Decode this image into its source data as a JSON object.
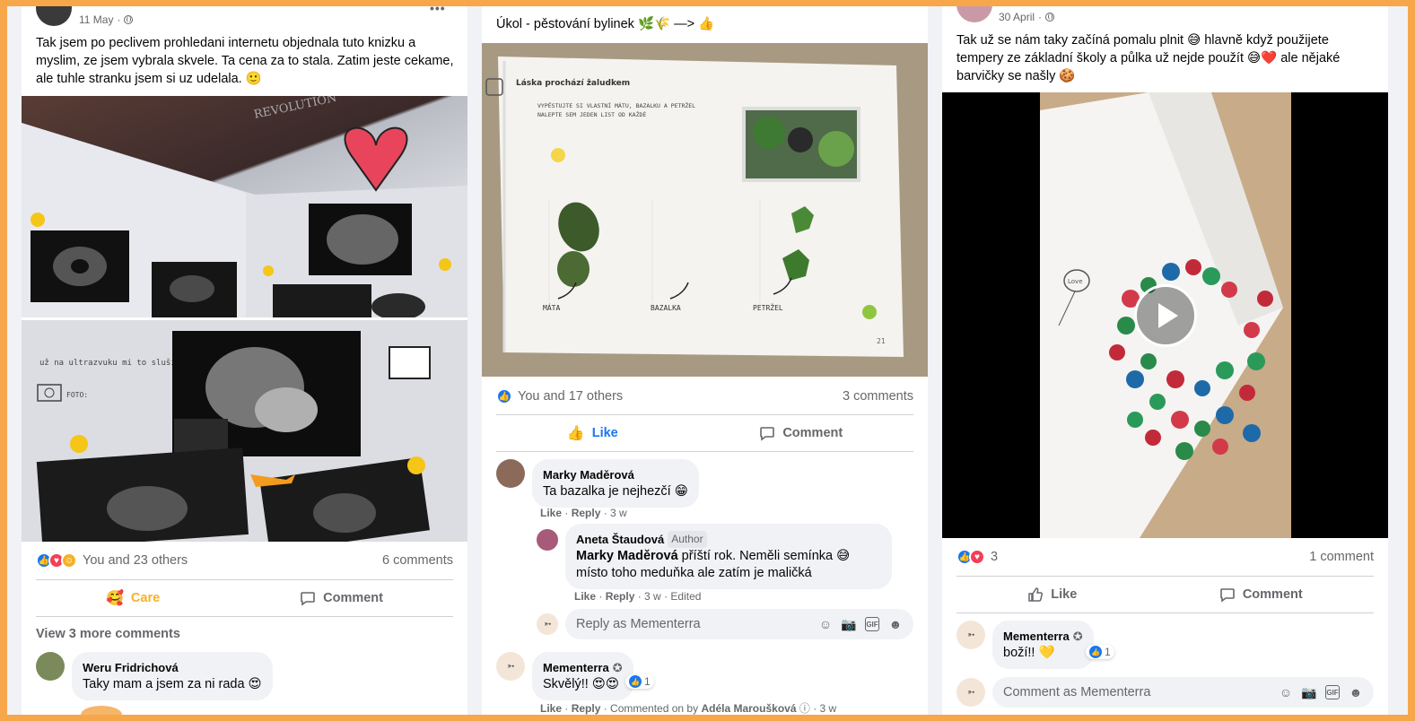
{
  "posts": [
    {
      "date": "11 May",
      "text": "Tak jsem po peclivem prohledani internetu objednala tuto knizku a myslim, ze jsem vybrala skvele. Ta cena za to stala. Zatim jeste cekame, ale tuhle stranku jsem si uz udelala. 🙂",
      "photo_caption": "už na ultrazvuku mi to sluší.",
      "photo_logo": "REVOLUTION",
      "photo_foto": "FOTO:",
      "reactions_text": "You and 23 others",
      "comments_count": "6 comments",
      "action_primary": "Care",
      "action_comment": "Comment",
      "view_more": "View 3 more comments",
      "comments": [
        {
          "name": "Weru Fridrichová",
          "text": "Taky mam a jsem za ni rada 😍"
        }
      ]
    },
    {
      "title": "Úkol - pěstování bylinek 🌿🌾 —> 👍",
      "photo_header": "Láska prochází žaludkem",
      "photo_instructions": "VYPĚSTUJTE SI VLASTNÍ MÁTU, BAZALKU A PETRŽEL. NALEPTE SEM JEDEN LIST OD KAŽDÉ.",
      "herb_labels": [
        "MÁTA",
        "BAZALKA",
        "PETRŽEL"
      ],
      "page_number": "21",
      "reactions_text": "You and 17 others",
      "comments_count": "3 comments",
      "action_primary": "Like",
      "action_comment": "Comment",
      "comments": [
        {
          "name": "Marky Maděrová",
          "text": "Ta bazalka je nejhezčí 😁",
          "actions": {
            "like": "Like",
            "reply": "Reply",
            "time": "3 w"
          }
        },
        {
          "name": "Aneta Štaudová",
          "badge": "Author",
          "mention": "Marky Maděrová",
          "text": " příští rok. Neměli semínka 😅 místo toho meduňka ale zatím je maličká",
          "actions": {
            "like": "Like",
            "reply": "Reply",
            "time": "3 w",
            "edited": "Edited"
          }
        },
        {
          "name": "Mementerra",
          "text": "Skvělý!! 😍😍",
          "react_count": "1",
          "actions": {
            "like": "Like",
            "reply": "Reply",
            "extra": "Commented on by",
            "extra_name": "Adéla Maroušková",
            "time": "3 w"
          }
        }
      ],
      "reply_placeholder": "Reply as Mementerra"
    },
    {
      "date": "30 April",
      "text": "Tak už se nám taky začíná pomalu plnit 😅 hlavně když použijete tempery ze základní školy a půlka už nejde použít 😅❤️ ale nějaké barvičky se našly 🍪",
      "photo_love": "Love",
      "reactions_text": "3",
      "comments_count": "1 comment",
      "action_primary": "Like",
      "action_comment": "Comment",
      "comments": [
        {
          "name": "Mementerra",
          "text": "boží!! 💛",
          "react_count": "1"
        }
      ],
      "comment_placeholder": "Comment as Mementerra"
    }
  ],
  "icons": {
    "like": "like-icon",
    "love": "love-icon",
    "care": "care-icon",
    "comment": "comment-icon",
    "emoji": "emoji-icon",
    "camera": "camera-icon",
    "gif": "gif-icon",
    "sticker": "sticker-icon",
    "play": "play-icon"
  },
  "colors": {
    "frame": "#f7a74a",
    "facebook_blue": "#1877f2",
    "care_yellow": "#f7b125",
    "love_red": "#f33e58"
  }
}
